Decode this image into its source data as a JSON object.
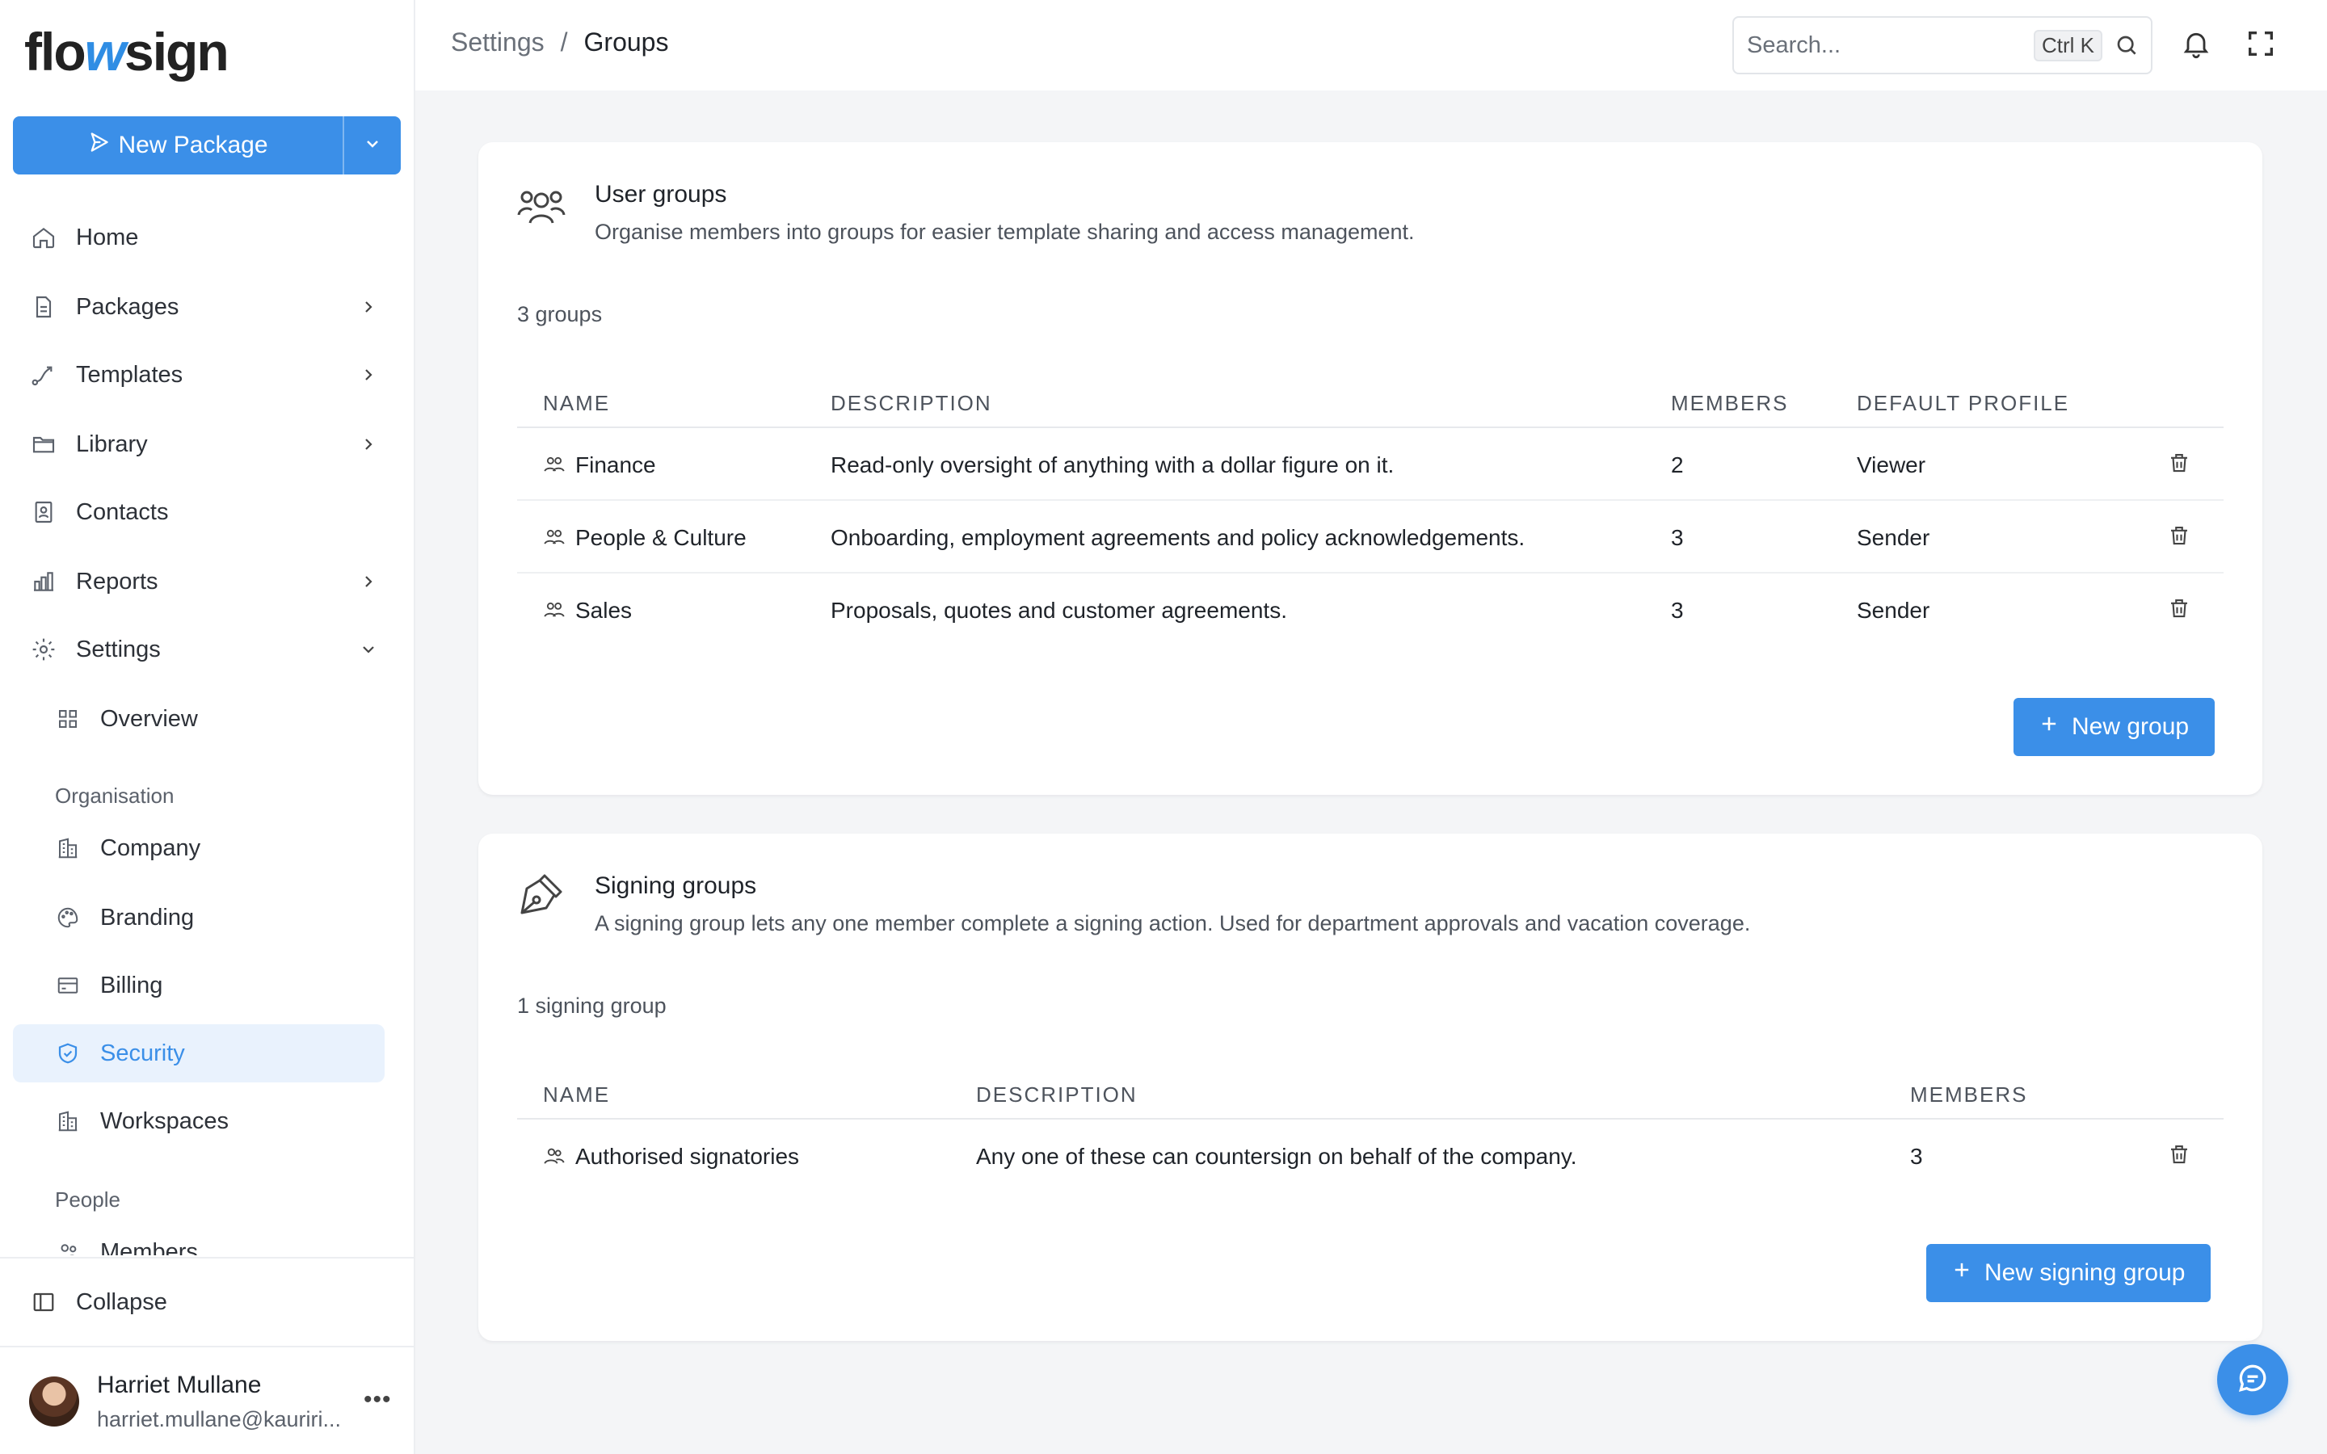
{
  "brand": {
    "logo_pre": "flo",
    "logo_w": "w",
    "logo_post": "sign"
  },
  "sidebar": {
    "new_package_label": "New Package",
    "items": [
      {
        "label": "Home"
      },
      {
        "label": "Packages"
      },
      {
        "label": "Templates"
      },
      {
        "label": "Library"
      },
      {
        "label": "Contacts"
      },
      {
        "label": "Reports"
      },
      {
        "label": "Settings"
      }
    ],
    "settings_overview": "Overview",
    "section_organisation": "Organisation",
    "org_items": [
      {
        "label": "Company"
      },
      {
        "label": "Branding"
      },
      {
        "label": "Billing"
      },
      {
        "label": "Security"
      },
      {
        "label": "Workspaces"
      }
    ],
    "section_people": "People",
    "people_items": [
      {
        "label": "Members"
      }
    ],
    "collapse_label": "Collapse",
    "user": {
      "name": "Harriet Mullane",
      "email": "harriet.mullane@kauriri..."
    }
  },
  "topbar": {
    "breadcrumb_parent": "Settings",
    "breadcrumb_sep": "/",
    "breadcrumb_current": "Groups",
    "search_placeholder": "Search...",
    "search_shortcut": "Ctrl K"
  },
  "user_groups": {
    "title": "User groups",
    "subtitle": "Organise members into groups for easier template sharing and access management.",
    "count": "3 groups",
    "columns": {
      "name": "NAME",
      "description": "DESCRIPTION",
      "members": "MEMBERS",
      "profile": "DEFAULT PROFILE"
    },
    "rows": [
      {
        "name": "Finance",
        "description": "Read-only oversight of anything with a dollar figure on it.",
        "members": "2",
        "profile": "Viewer"
      },
      {
        "name": "People & Culture",
        "description": "Onboarding, employment agreements and policy acknowledgements.",
        "members": "3",
        "profile": "Sender"
      },
      {
        "name": "Sales",
        "description": "Proposals, quotes and customer agreements.",
        "members": "3",
        "profile": "Sender"
      }
    ],
    "new_button": "New group"
  },
  "signing_groups": {
    "title": "Signing groups",
    "subtitle": "A signing group lets any one member complete a signing action. Used for department approvals and vacation coverage.",
    "count": "1 signing group",
    "columns": {
      "name": "NAME",
      "description": "DESCRIPTION",
      "members": "MEMBERS"
    },
    "rows": [
      {
        "name": "Authorised signatories",
        "description": "Any one of these can countersign on behalf of the company.",
        "members": "3"
      }
    ],
    "new_button": "New signing group"
  },
  "colors": {
    "accent": "#3b8fe8",
    "active_bg": "#e9f2fd",
    "page_bg": "#f4f5f7"
  }
}
